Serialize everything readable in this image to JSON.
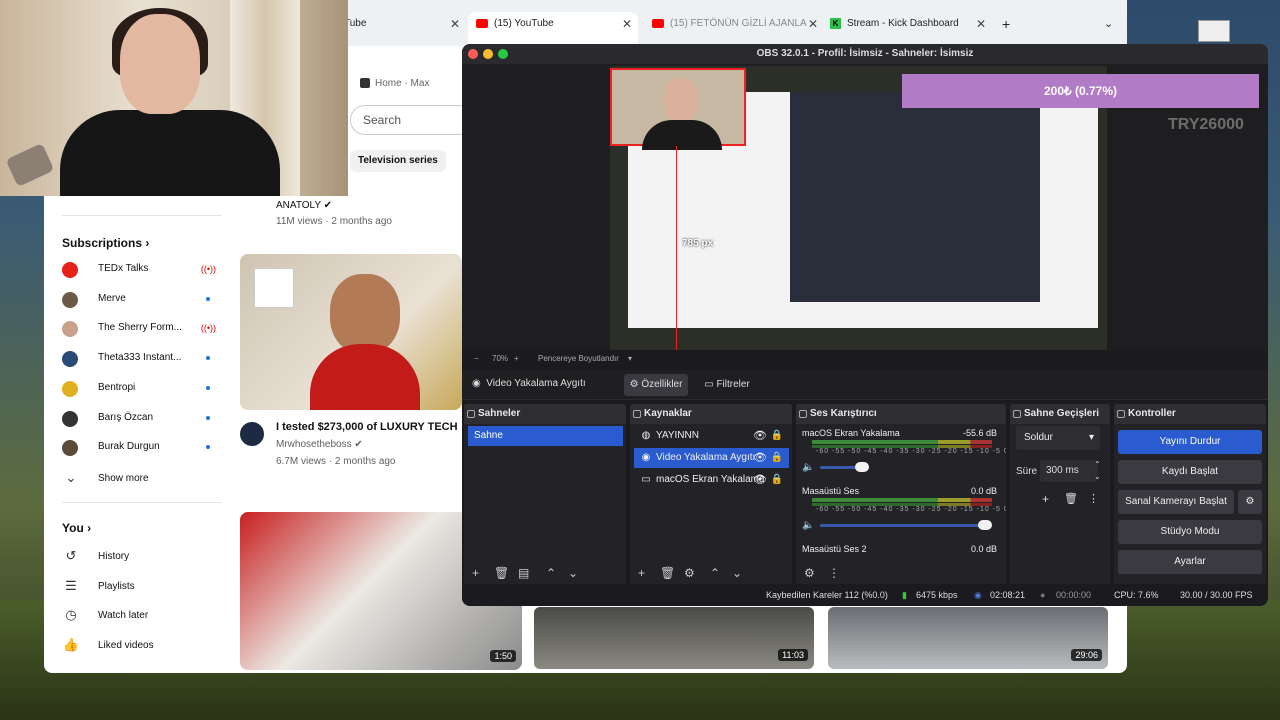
{
  "browser": {
    "tabs": [
      {
        "label": "Tube",
        "active": false
      },
      {
        "label": "(15) YouTube",
        "active": true
      },
      {
        "label": "(15) FETÖNÜN GİZLİ AJANLA",
        "active": false
      },
      {
        "label": "Stream - Kick Dashboard",
        "active": false
      }
    ],
    "new_tab": "+",
    "close": "✕",
    "bookmarks": [
      "Home · Max"
    ],
    "search_placeholder": "Search",
    "chip": "Television series"
  },
  "youtube": {
    "subscriptions_title": "Subscriptions",
    "subscriptions": [
      {
        "name": "TEDx Talks",
        "live": true,
        "color": "#e62117"
      },
      {
        "name": "Merve",
        "live": false,
        "color": "#6a5a4a"
      },
      {
        "name": "The Sherry Form...",
        "live": true,
        "color": "#c9a08a"
      },
      {
        "name": "Theta333 Instant...",
        "live": false,
        "color": "#2b4a7a"
      },
      {
        "name": "Bentropi",
        "live": false,
        "color": "#e0b020"
      },
      {
        "name": "Barış Özcan",
        "live": false,
        "color": "#333333"
      },
      {
        "name": "Burak Durgun",
        "live": false,
        "color": "#5a4a3a"
      }
    ],
    "show_more": "Show more",
    "you_title": "You",
    "you_items": [
      {
        "label": "History",
        "icon": "history-icon",
        "glyph": "↺"
      },
      {
        "label": "Playlists",
        "icon": "playlists-icon",
        "glyph": "☰"
      },
      {
        "label": "Watch later",
        "icon": "clock-icon",
        "glyph": "◷"
      },
      {
        "label": "Liked videos",
        "icon": "thumbs-up-icon",
        "glyph": "👍"
      }
    ],
    "video1": {
      "channel": "ANATOLY",
      "meta": "11M views · 2 months ago"
    },
    "video2": {
      "title": "I tested $273,000 of LUXURY TECH",
      "channel": "Mrwhosetheboss",
      "meta": "6.7M views · 2 months ago"
    },
    "durations": [
      "1:50",
      "11:03",
      "29:06"
    ]
  },
  "obs": {
    "title": "OBS 32.0.1 - Profil: İsimsiz - Sahneler: İsimsiz",
    "preview": {
      "alert_text": "200₺ (0.77%)",
      "watermark": "TRY26000",
      "measure": "785 px"
    },
    "zoom": {
      "level": "70%",
      "fit": "Pencereye Boyutlandır"
    },
    "source_toolbar": {
      "source": "Video Yakalama Aygıtı",
      "properties": "Özellikler",
      "filters": "Filtreler"
    },
    "docks": {
      "scenes": "Sahneler",
      "sources": "Kaynaklar",
      "mixer": "Ses Karıştırıcı",
      "transitions": "Sahne Geçişleri",
      "controls": "Kontroller"
    },
    "scenes": [
      "Sahne"
    ],
    "sources": [
      {
        "label": "YAYINNN",
        "icon": "browser-source-icon",
        "selected": false
      },
      {
        "label": "Video Yakalama Aygıtı",
        "icon": "camera-icon",
        "selected": true
      },
      {
        "label": "macOS Ekran Yakalama",
        "icon": "monitor-icon",
        "selected": false
      }
    ],
    "mixer": [
      {
        "name": "macOS Ekran Yakalama",
        "db": "-55.6 dB",
        "level": 0.22
      },
      {
        "name": "Masaüstü Ses",
        "db": "0.0 dB",
        "level": 1.0
      },
      {
        "name": "Masaüstü Ses 2",
        "db": "0.0 dB",
        "level": 1.0
      }
    ],
    "meter_scale": "-60 -55 -50 -45 -40 -35 -30 -25 -20 -15 -10 -5 0",
    "transitions": {
      "type": "Soldur",
      "duration_label": "Süre",
      "duration": "300 ms"
    },
    "controls": [
      "Yayını Durdur",
      "Kaydı Başlat",
      "Sanal Kamerayı Başlat",
      "Stüdyo Modu",
      "Ayarlar"
    ],
    "status": {
      "dropped": "Kaybedilen Kareler 112 (%0.0)",
      "bitrate": "6475 kbps",
      "stream_time": "02:08:21",
      "rec_time": "00:00:00",
      "cpu": "CPU: 7.6%",
      "fps": "30.00 / 30.00 FPS"
    }
  },
  "colors": {
    "obs_accent": "#2a5cd0",
    "alert_bg": "#b27bc6",
    "youtube_red": "#ff0000"
  }
}
